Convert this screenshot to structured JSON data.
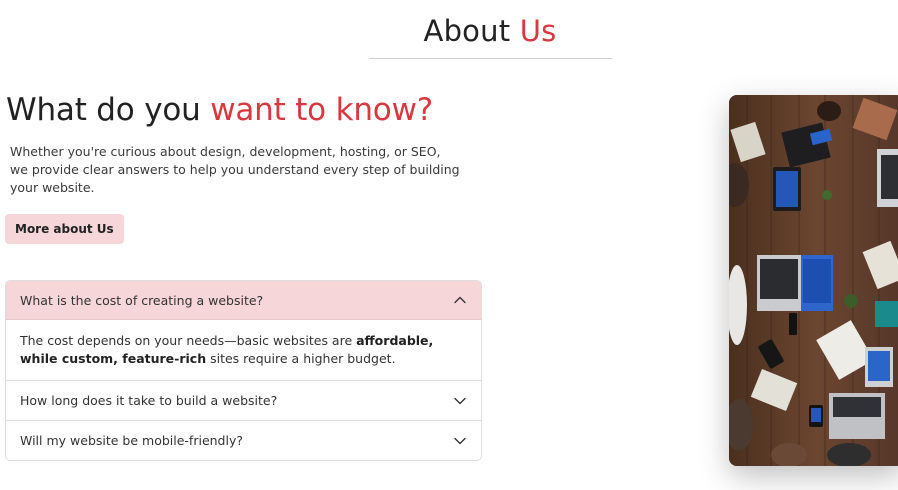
{
  "header": {
    "title_part1": "About",
    "title_part2": "Us"
  },
  "hero": {
    "title_part1": "What do you",
    "title_part2": "want to know?",
    "description": "Whether you're curious about design, development, hosting, or SEO, we provide clear answers to help you understand every step of building your website.",
    "button_label": "More about Us"
  },
  "faq": {
    "items": [
      {
        "question": "What is the cost of creating a website?",
        "open": true,
        "answer_part1": "The cost depends on your needs—basic websites are ",
        "answer_bold": "affordable, while custom, feature-rich",
        "answer_part2": " sites require a higher budget."
      },
      {
        "question": "How long does it take to build a website?",
        "open": false
      },
      {
        "question": "Will my website be mobile-friendly?",
        "open": false
      }
    ]
  },
  "colors": {
    "accent": "#d9383f",
    "pill_bg": "#f6d6d8",
    "text": "#222222"
  },
  "icons": {
    "open": "chevron-up-icon",
    "closed": "chevron-down-icon"
  }
}
